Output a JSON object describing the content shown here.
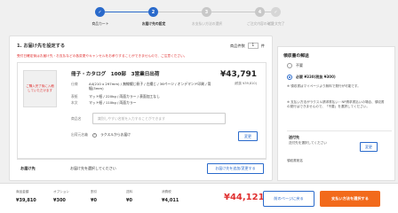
{
  "stepper": {
    "steps": [
      {
        "num": "✓",
        "label": "商品カート",
        "state": "done"
      },
      {
        "num": "2",
        "label": "お届け先の設定",
        "state": "current"
      },
      {
        "num": "3",
        "label": "お支払い方法の選択",
        "state": "todo"
      },
      {
        "num": "4",
        "label": "ご注文内容の確認",
        "state": "todo"
      },
      {
        "num": "✓",
        "label": "ご注文完了",
        "state": "todo"
      }
    ],
    "colors": {
      "active": "#2a6acb",
      "inactive": "#c8c8c8"
    }
  },
  "main": {
    "heading": "1. お届け先を設定する",
    "qty_label": "商品件数",
    "qty_value": "1",
    "qty_unit": "件",
    "notice": "受付日確定後はお届け先・お支払などの各変更やキャンセルをお承りすることができませんので、ご注意ください。",
    "item": {
      "thumb_text": "ご購入完了後に入稿していただけます",
      "title": "冊子・カタログ　100部　3営業日出荷",
      "price": "¥43,791",
      "tax_note": "(税抜 ¥39,810)",
      "specs": [
        {
          "key": "仕様",
          "value": "A4(210 x 297mm) / 無線綴じ冊子 / 左綴じ / 36ページ / オンデマンド印刷 / 背幅(3mm)"
        },
        {
          "key": "表紙",
          "value": "マット紙 / 220kg / 両面カラー / 表面加工なし"
        },
        {
          "key": "本文",
          "value": "マット紙 / 110kg / 両面カラー"
        }
      ],
      "name_label": "商品名",
      "name_placeholder": "識別しやすい名前を入力することができます",
      "option_label": "出荷元名義",
      "option_value": "ラクスルからお届け",
      "change_button": "変更"
    },
    "shipping": {
      "label": "お届け先",
      "text": "お届け先を選択してください",
      "button": "お届け先を追加/変更する"
    }
  },
  "side": {
    "heading": "領収書の郵送",
    "options": [
      {
        "label": "不要",
        "selected": false
      },
      {
        "label": "必要 ¥330(税抜 ¥300)",
        "selected": true
      }
    ],
    "notes": [
      "※ 領収書はマイページより無料で発行が可能です。",
      "※ 支払い方法がラクスル請求書払い・NP請求書払いの場合、領収書の発行はできませんので、「不要」を選択してください。"
    ],
    "address": {
      "heading": "送付先",
      "text": "送付先を選択してください",
      "button": "変更"
    },
    "recipient_label": "領収書宛名"
  },
  "summary": {
    "items": [
      {
        "key": "商品金額",
        "value": "¥39,810"
      },
      {
        "key": "オプション",
        "value": "¥300"
      },
      {
        "key": "割引",
        "value": "¥0"
      },
      {
        "key": "送料",
        "value": "¥0"
      },
      {
        "key": "消費税",
        "value": "¥4,011"
      }
    ],
    "total": "¥44,121",
    "back_button": "前のページに戻る",
    "next_button": "支払い方法を選択する"
  }
}
